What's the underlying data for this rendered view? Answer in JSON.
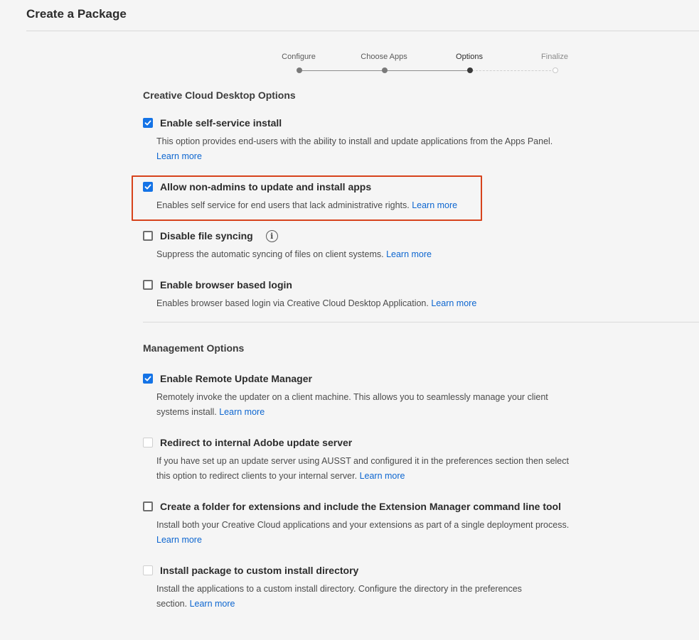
{
  "page": {
    "title": "Create a Package"
  },
  "stepper": {
    "steps": [
      {
        "label": "Configure",
        "state": "done"
      },
      {
        "label": "Choose Apps",
        "state": "done"
      },
      {
        "label": "Options",
        "state": "active"
      },
      {
        "label": "Finalize",
        "state": "future"
      }
    ]
  },
  "ccd": {
    "title": "Creative Cloud Desktop Options",
    "options": [
      {
        "label": "Enable self-service install",
        "checked": true,
        "desc": "This option provides end-users with the ability to install and update applications from the Apps Panel.",
        "link": "Learn more"
      },
      {
        "label": "Allow non-admins to update and install apps",
        "checked": true,
        "desc": "Enables self service for end users that lack administrative rights.",
        "link": "Learn more"
      },
      {
        "label": "Disable file syncing",
        "checked": false,
        "info_icon": "info-icon",
        "desc": "Suppress the automatic syncing of files on client systems.",
        "link": "Learn more"
      },
      {
        "label": "Enable browser based login",
        "checked": false,
        "desc": "Enables browser based login via Creative Cloud Desktop Application.",
        "link": "Learn more"
      }
    ]
  },
  "mgmt": {
    "title": "Management Options",
    "options": [
      {
        "label": "Enable Remote Update Manager",
        "checked": true,
        "desc": "Remotely invoke the updater on a client machine. This allows you to seamlessly manage your client systems install.",
        "link": "Learn more"
      },
      {
        "label": "Redirect to internal Adobe update server",
        "checked": false,
        "disabled": true,
        "desc": "If you have set up an update server using AUSST and configured it in the preferences section then select this option to redirect clients to your internal server.",
        "link": "Learn more"
      },
      {
        "label": "Create a folder for extensions and include the Extension Manager command line tool",
        "checked": false,
        "desc": "Install both your Creative Cloud applications and your extensions as part of a single deployment process.",
        "link": "Learn more"
      },
      {
        "label": "Install package to custom install directory",
        "checked": false,
        "disabled": true,
        "desc": "Install the applications to a custom install directory. Configure the directory in the preferences section.",
        "link": "Learn more"
      }
    ]
  },
  "colors": {
    "accent": "#1473e6",
    "link": "#0d66d0",
    "highlight": "#d7431c"
  }
}
